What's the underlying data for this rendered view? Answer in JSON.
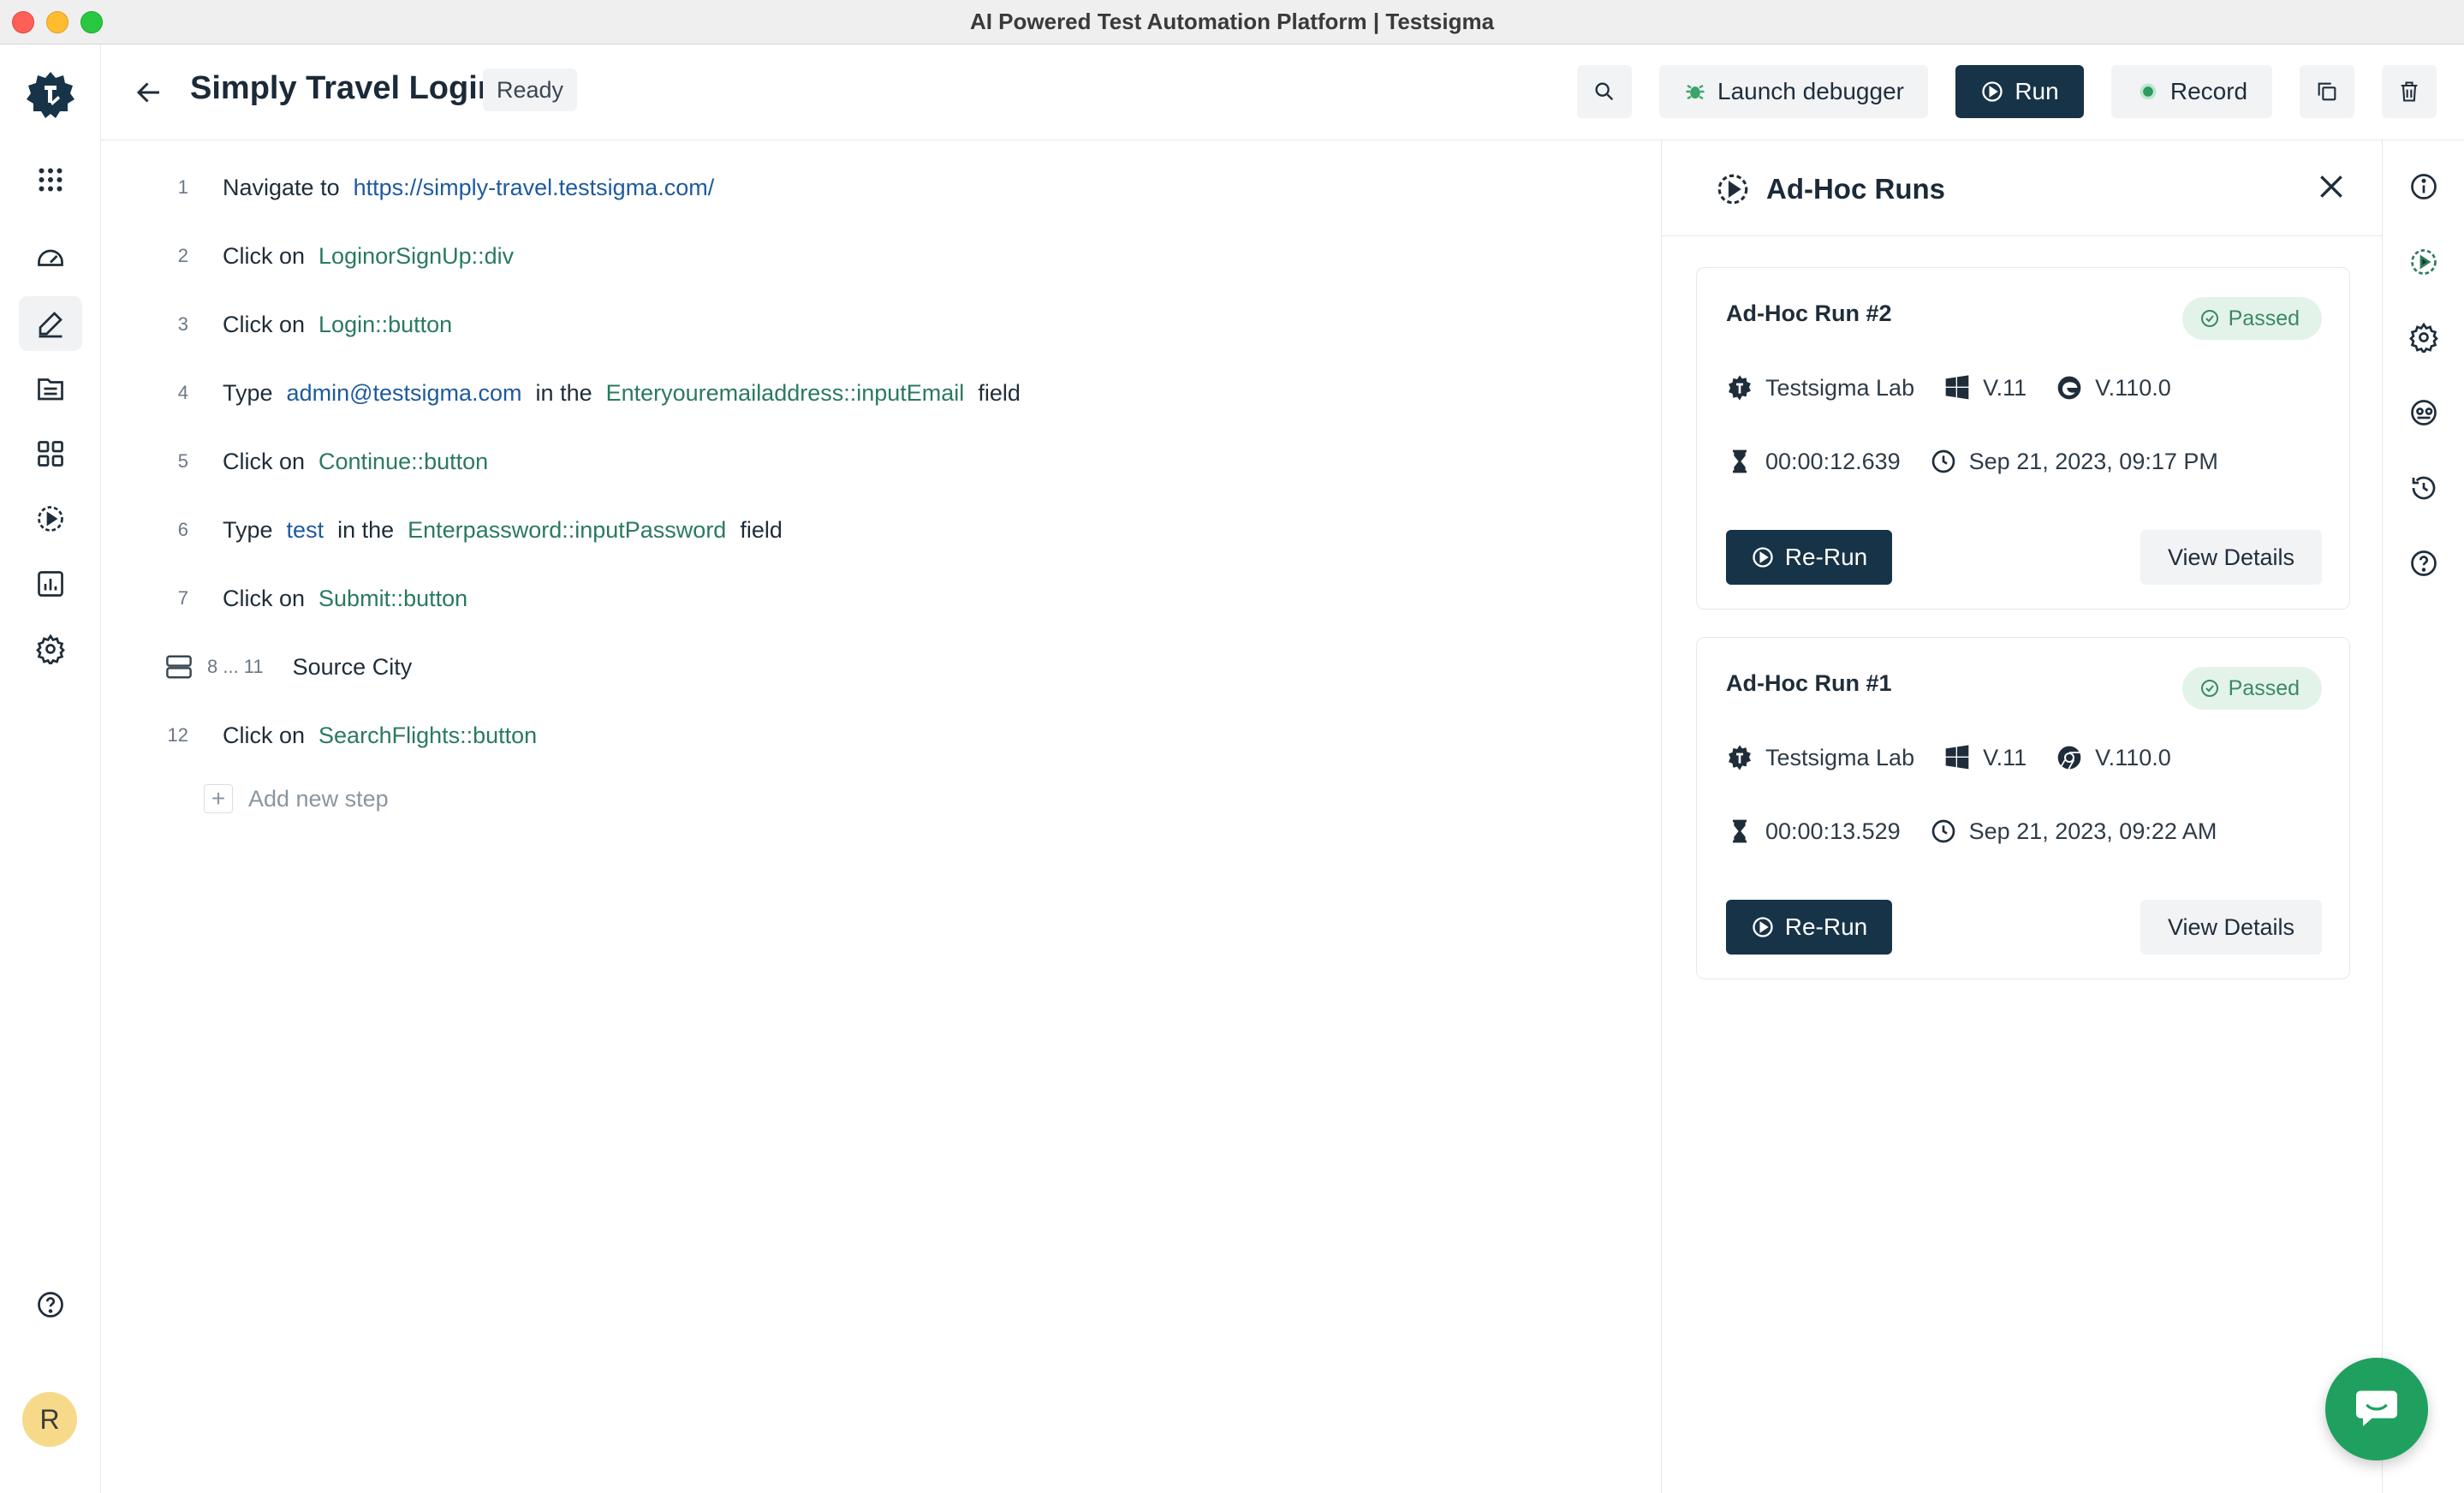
{
  "window": {
    "title": "AI Powered Test Automation Platform | Testsigma"
  },
  "sidebar": {
    "items": [
      {
        "name": "apps-grid-icon"
      },
      {
        "name": "dashboard-icon"
      },
      {
        "name": "edit-icon"
      },
      {
        "name": "folder-icon"
      },
      {
        "name": "modules-icon"
      },
      {
        "name": "runs-icon"
      },
      {
        "name": "reports-icon"
      },
      {
        "name": "settings-icon"
      }
    ],
    "help_icon": "help-icon",
    "avatar_letter": "R"
  },
  "header": {
    "title": "Simply Travel Login",
    "status": "Ready",
    "search_icon": "search-icon",
    "debugger_label": "Launch debugger",
    "run_label": "Run",
    "record_label": "Record"
  },
  "steps": [
    {
      "num": "1",
      "parts": [
        {
          "t": "kw",
          "v": "Navigate to"
        },
        {
          "t": "lnk",
          "v": "https://simply-travel.testsigma.com/"
        }
      ]
    },
    {
      "num": "2",
      "parts": [
        {
          "t": "kw",
          "v": "Click on"
        },
        {
          "t": "el",
          "v": "LoginorSignUp::div"
        }
      ]
    },
    {
      "num": "3",
      "parts": [
        {
          "t": "kw",
          "v": "Click on"
        },
        {
          "t": "el",
          "v": "Login::button"
        }
      ]
    },
    {
      "num": "4",
      "parts": [
        {
          "t": "kw",
          "v": "Type"
        },
        {
          "t": "lnk",
          "v": "admin@testsigma.com"
        },
        {
          "t": "txt",
          "v": "in the"
        },
        {
          "t": "el",
          "v": "Enteryouremailaddress::inputEmail"
        },
        {
          "t": "txt",
          "v": "field"
        }
      ]
    },
    {
      "num": "5",
      "parts": [
        {
          "t": "kw",
          "v": "Click on"
        },
        {
          "t": "el",
          "v": "Continue::button"
        }
      ]
    },
    {
      "num": "6",
      "parts": [
        {
          "t": "kw",
          "v": "Type"
        },
        {
          "t": "lnk",
          "v": "test"
        },
        {
          "t": "txt",
          "v": "in the"
        },
        {
          "t": "el",
          "v": "Enterpassword::inputPassword"
        },
        {
          "t": "txt",
          "v": "field"
        }
      ]
    },
    {
      "num": "7",
      "parts": [
        {
          "t": "kw",
          "v": "Click on"
        },
        {
          "t": "el",
          "v": "Submit::button"
        }
      ]
    },
    {
      "num": "8 ... 11",
      "group": true,
      "parts": [
        {
          "t": "txt",
          "v": "Source City"
        }
      ]
    },
    {
      "num": "12",
      "parts": [
        {
          "t": "kw",
          "v": "Click on"
        },
        {
          "t": "el",
          "v": "SearchFlights::button"
        }
      ]
    }
  ],
  "add_step_label": "Add new step",
  "panel": {
    "title": "Ad-Hoc Runs",
    "runs": [
      {
        "title": "Ad-Hoc Run #2",
        "status": "Passed",
        "lab": "Testsigma Lab",
        "os_version": "V.11",
        "browser": "edge",
        "browser_version": "V.110.0",
        "duration": "00:00:12.639",
        "date": "Sep 21, 2023, 09:17 PM",
        "rerun_label": "Re-Run",
        "details_label": "View Details"
      },
      {
        "title": "Ad-Hoc Run #1",
        "status": "Passed",
        "lab": "Testsigma Lab",
        "os_version": "V.11",
        "browser": "chrome",
        "browser_version": "V.110.0",
        "duration": "00:00:13.529",
        "date": "Sep 21, 2023, 09:22 AM",
        "rerun_label": "Re-Run",
        "details_label": "View Details"
      }
    ]
  },
  "rail": [
    "info-icon",
    "adhoc-runs-icon",
    "settings-icon",
    "agent-icon",
    "history-icon",
    "help-icon"
  ],
  "colors": {
    "primary_dark": "#173347",
    "accent_green": "#1fa05f",
    "passed_bg": "#e3f3ea",
    "highlight_border": "#e0463c"
  }
}
